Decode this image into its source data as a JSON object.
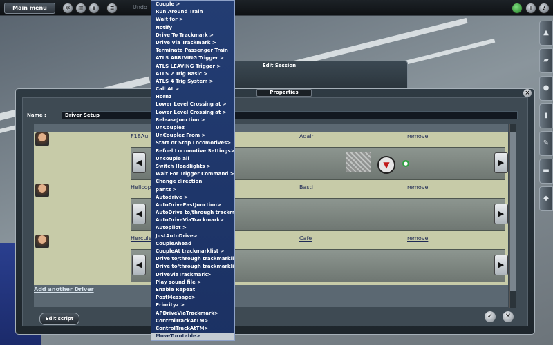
{
  "topbar": {
    "main_menu_label": "Main menu",
    "undo_label": "Undo",
    "left_icons": [
      "compass-icon",
      "trash-icon",
      "info-icon",
      "layers-icon"
    ],
    "right_icons": [
      "status-light-icon",
      "plus-icon",
      "help-icon"
    ]
  },
  "edit_session": {
    "title": "Edit Session"
  },
  "properties": {
    "title": "Properties",
    "name_label": "Name :",
    "name_value": "Driver Setup",
    "drivers": [
      {
        "train": "F18Au",
        "driver": "Adair",
        "remove": "remove"
      },
      {
        "train": "Helicop",
        "driver": "Basti",
        "remove": "remove"
      },
      {
        "train": "Hercule",
        "driver": "Cafe",
        "remove": "remove"
      }
    ],
    "add_driver": "Add another Driver",
    "edit_script": "Edit script"
  },
  "menu": {
    "items": [
      "Couple >",
      "Run Around Train",
      "Wait for >",
      "Notify",
      "Drive To Trackmark >",
      "Drive Via Trackmark >",
      "Terminate Passenger Train",
      "ATLS ARRIVING Trigger >",
      "ATLS LEAVING Trigger >",
      "ATLS 2 Trig Basic >",
      "ATLS 4 Trig System >",
      "Call At >",
      "Hornz",
      "Lower Level Crossing at >",
      "Lower Level Crossing at >",
      "ReleaseJunction >",
      "UnCouplez",
      "UnCouplez From >",
      "Start or Stop Locomotives>",
      "Refuel Locomotive Settings>",
      "Uncouple all",
      "Switch Headlights >",
      "Wait For Trigger Command >",
      "Change direction",
      "pantz >",
      "Autodrive >",
      "AutoDrivePastJunction>",
      "AutoDrive to/through trackmar...",
      "AutoDriveViaTrackmark>",
      "Autopilot >",
      "JustAutoDrive>",
      "CoupleAhead",
      "CoupleAt trackmarklist >",
      "Drive to/through trackmarklist >",
      "Drive to/through trackmarklist >",
      "DriveViaTrackmark>",
      "Play sound file >",
      "Enable Repeat",
      "PostMessage>",
      "Priorityz >",
      "APDriveViaTrackmark>",
      "ControlTrackAtTM>",
      "ControlTrackAtTM>",
      "MoveTurntable>"
    ],
    "selected_index": 43
  }
}
